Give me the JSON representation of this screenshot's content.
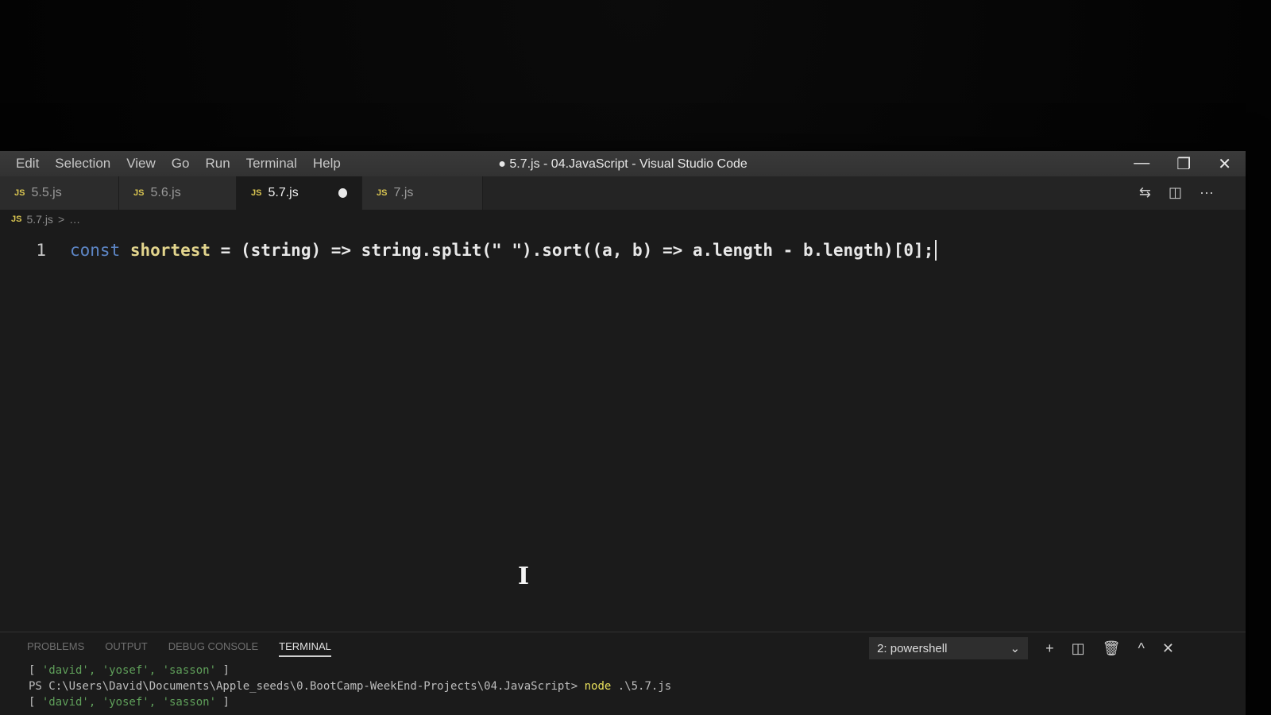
{
  "menu": [
    "Edit",
    "Selection",
    "View",
    "Go",
    "Run",
    "Terminal",
    "Help"
  ],
  "window_title": "● 5.7.js - 04.JavaScript - Visual Studio Code",
  "window_controls": {
    "minimize": "—",
    "restore": "❐",
    "close": "✕"
  },
  "tabs": [
    {
      "icon": "JS",
      "label": "5.5.js"
    },
    {
      "icon": "JS",
      "label": "5.6.js"
    },
    {
      "icon": "JS",
      "label": "5.7.js",
      "active": true
    },
    {
      "icon": "JS",
      "label": "7.js"
    }
  ],
  "editor_actions": {
    "compare": "⇆",
    "split": "◫",
    "more": "···"
  },
  "breadcrumb": {
    "icon": "JS",
    "file": "5.7.js",
    "sep": ">",
    "trail": "…"
  },
  "code": {
    "line_number": "1",
    "kw": "const",
    "name": "shortest",
    "rest": " = (string) => string.split(\" \").sort((a, b) => a.length - b.length)[0];"
  },
  "cursor_glyph": "I",
  "panel": {
    "tabs": [
      "PROBLEMS",
      "OUTPUT",
      "DEBUG CONSOLE",
      "TERMINAL"
    ],
    "shell": "2: powershell",
    "chevron": "⌄",
    "add": "+",
    "split": "◫",
    "trash": "🗑",
    "maximize": "^",
    "close": "✕"
  },
  "terminal": {
    "line1_open": "[ ",
    "line1_items": "'david', 'yosef', 'sasson'",
    "line1_close": " ]",
    "line2_prompt": "PS C:\\Users\\David\\Documents\\Apple_seeds\\0.BootCamp-WeekEnd-Projects\\04.JavaScript> ",
    "line2_cmd": "node",
    "line2_arg": " .\\5.7.js",
    "line3_open": "[ ",
    "line3_items": "'david', 'yosef', 'sasson'",
    "line3_close": " ]"
  }
}
